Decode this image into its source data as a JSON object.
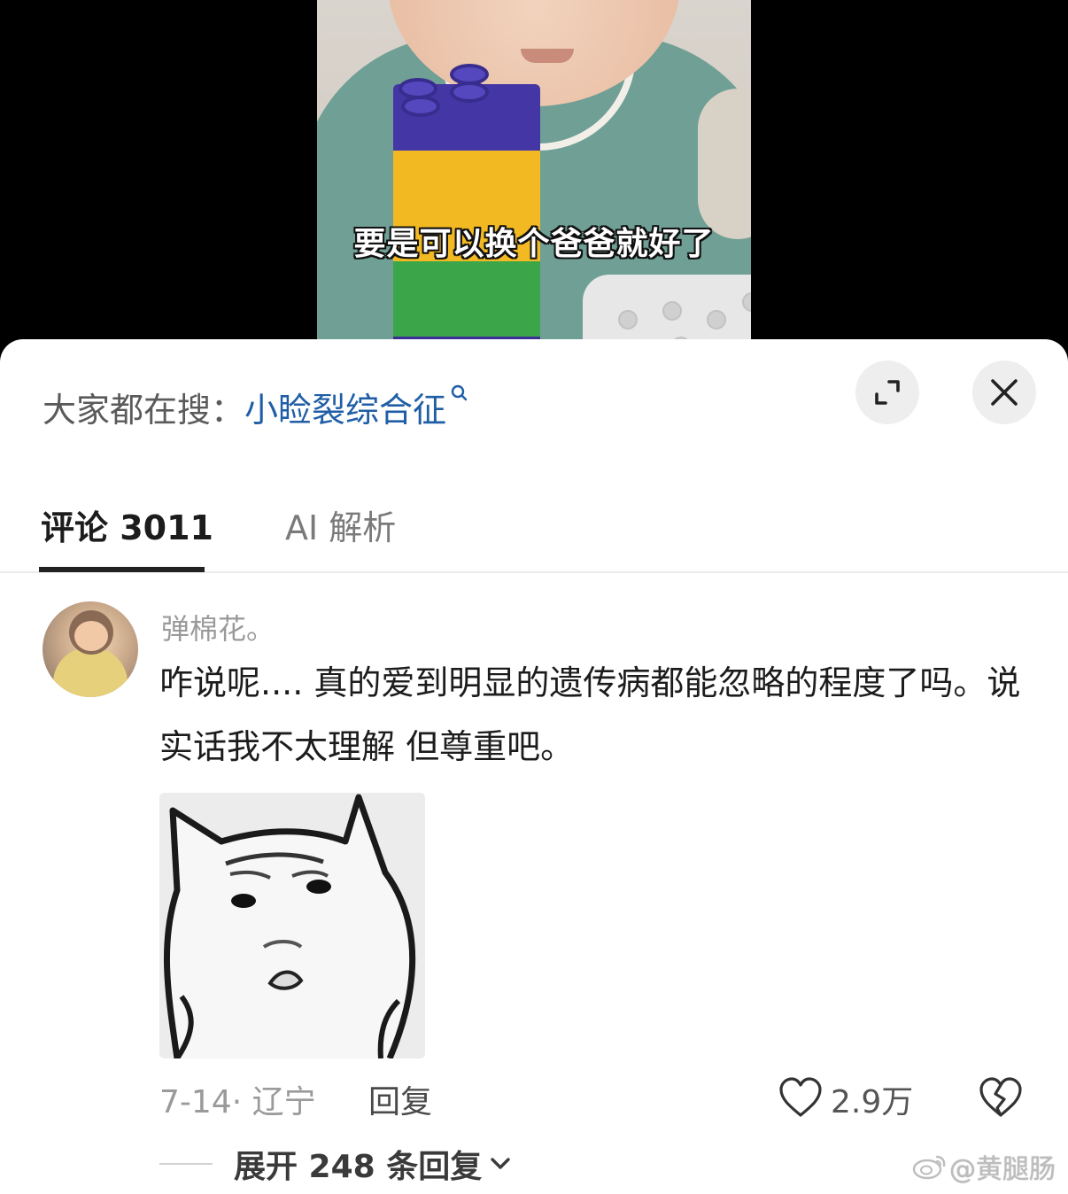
{
  "video": {
    "subtitle": "要是可以换个爸爸就好了"
  },
  "sheet": {
    "search_prefix": "大家都在搜：",
    "search_term": "小睑裂综合征",
    "icons": {
      "search_mini": "search-icon",
      "expand": "expand-icon",
      "close": "close-icon"
    }
  },
  "tabs": [
    {
      "label": "评论 3011",
      "active": true
    },
    {
      "label": "AI 解析",
      "active": false
    }
  ],
  "comment": {
    "username": "弹棉花。",
    "text": "咋说呢.... 真的爱到明显的遗传病都能忽略的程度了吗。说实话我不太理解 但尊重吧。",
    "date_location": "7-14· 辽宁",
    "reply_label": "回复",
    "like_count": "2.9万",
    "expand_replies": "展开 248 条回复"
  },
  "watermark": {
    "text": "@黄腿肠"
  },
  "colors": {
    "link_blue": "#1f5ea6",
    "text_primary": "#1c1c1c",
    "text_secondary": "#9a9a9a"
  }
}
